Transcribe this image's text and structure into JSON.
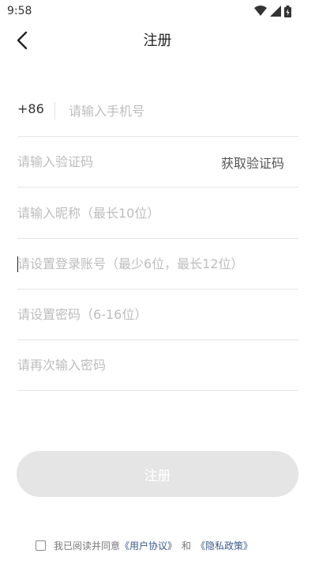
{
  "status_bar": {
    "time": "9:58"
  },
  "header": {
    "title": "注册"
  },
  "form": {
    "phone_prefix": "+86",
    "phone_placeholder": "请输入手机号",
    "code_placeholder": "请输入验证码",
    "get_code_label": "获取验证码",
    "nickname_placeholder": "请输入昵称（最长10位）",
    "account_placeholder": "请设置登录账号（最少6位，最长12位）",
    "password_placeholder": "请设置密码（6-16位）",
    "confirm_password_placeholder": "请再次输入密码"
  },
  "submit_label": "注册",
  "agreement": {
    "text": "我已阅读并同意",
    "user_agreement": "《用户协议》",
    "and_text": "和",
    "privacy_policy": "《隐私政策》"
  }
}
